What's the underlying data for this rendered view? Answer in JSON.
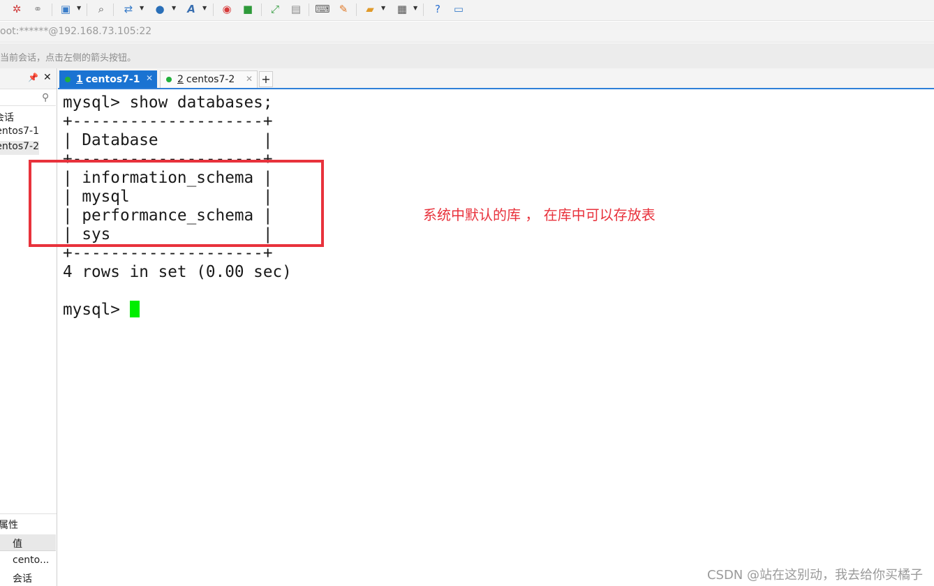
{
  "toolbar": {
    "icons": [
      "disconnect-icon",
      "reconnect-icon",
      "new-session-icon",
      "find-icon",
      "transfer-icon",
      "globe-icon",
      "font-icon",
      "xshell-icon",
      "xftp-icon",
      "fullscreen-icon",
      "lock-icon",
      "keyboard-icon",
      "highlight-icon",
      "add-script-icon",
      "layout-icon",
      "help-icon",
      "chat-icon"
    ]
  },
  "address_bar": {
    "text": "oot:******@192.168.73.105:22"
  },
  "hint_bar": {
    "text": "当前会话，点击左侧的箭头按钮。"
  },
  "left_pane": {
    "items": [
      {
        "label": "会话"
      },
      {
        "label": "entos7-1"
      },
      {
        "label": "entos7-2"
      }
    ],
    "properties": {
      "title": "属性",
      "value_header": "值",
      "rows": [
        "cento...",
        "会话"
      ]
    }
  },
  "tabs": [
    {
      "number": "1",
      "label": "centos7-1",
      "active": true
    },
    {
      "number": "2",
      "label": "centos7-2",
      "active": false
    }
  ],
  "terminal": {
    "lines": [
      "mysql> show databases;",
      "+--------------------+",
      "| Database           |",
      "+--------------------+",
      "| information_schema |",
      "| mysql              |",
      "| performance_schema |",
      "| sys                |",
      "+--------------------+",
      "4 rows in set (0.00 sec)",
      "",
      "mysql> "
    ]
  },
  "annotation": {
    "text": "系统中默认的库 ， 在库中可以存放表",
    "color": "#e8323c"
  },
  "watermark": {
    "text": "CSDN @站在这别动，我去给你买橘子"
  },
  "colors": {
    "tab_active": "#1a73d2",
    "cursor": "#00ee00",
    "annotation": "#e8323c"
  }
}
